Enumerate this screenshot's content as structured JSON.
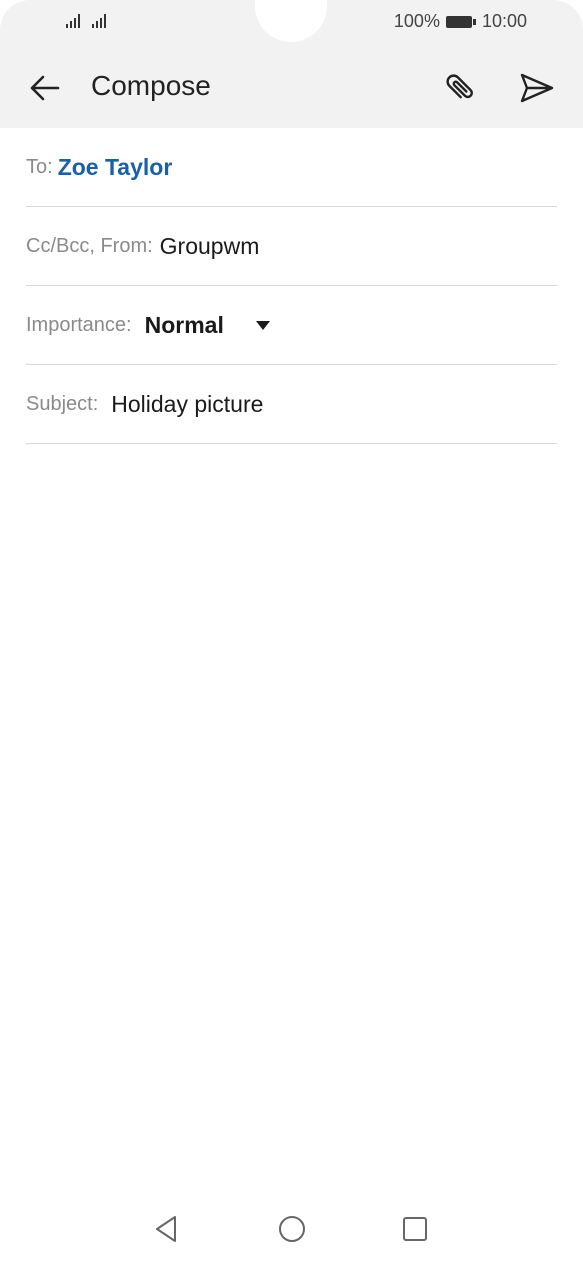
{
  "status_bar": {
    "battery_percent": "100%",
    "time": "10:00",
    "icons": [
      "signal-icon",
      "signal-icon",
      "battery-icon"
    ]
  },
  "app_bar": {
    "title": "Compose",
    "back_icon": "arrow-left-icon",
    "attach_icon": "paperclip-icon",
    "send_icon": "send-icon"
  },
  "form": {
    "to_label": "To:",
    "to_value": "Zoe Taylor",
    "cc_label": "Cc/Bcc, From:",
    "cc_value": "Groupwm",
    "importance_label": "Importance:",
    "importance_value": "Normal",
    "subject_label": "Subject:",
    "subject_value": "Holiday picture"
  },
  "nav_bar": {
    "icons": [
      "back-triangle-icon",
      "home-circle-icon",
      "recents-square-icon"
    ]
  },
  "colors": {
    "header_bg": "#f2f2f2",
    "recipient_blue": "#1a5fa8",
    "divider": "#d8d8d8"
  }
}
